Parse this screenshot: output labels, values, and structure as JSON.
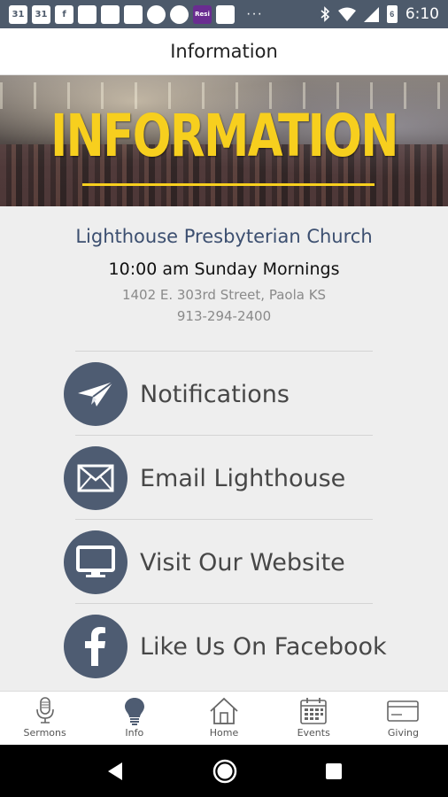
{
  "status_bar": {
    "app_icons": [
      "31",
      "31",
      "f",
      "",
      "",
      "",
      "",
      "",
      "Resi",
      ""
    ],
    "overflow": "···",
    "battery_level": "6",
    "time": "6:10"
  },
  "header": {
    "title": "Information"
  },
  "banner": {
    "text": "INFORMATION"
  },
  "church": {
    "name": "Lighthouse Presbyterian Church",
    "service_time": "10:00 am Sunday Mornings",
    "address": "1402 E. 303rd Street, Paola KS",
    "phone": "913-294-2400"
  },
  "menu": {
    "items": [
      {
        "label": "Notifications",
        "icon": "paper-plane-icon"
      },
      {
        "label": "Email Lighthouse",
        "icon": "envelope-icon"
      },
      {
        "label": "Visit Our Website",
        "icon": "monitor-icon"
      },
      {
        "label": "Like Us On Facebook",
        "icon": "facebook-icon"
      }
    ]
  },
  "bottom_nav": {
    "items": [
      {
        "label": "Sermons",
        "icon": "microphone-icon"
      },
      {
        "label": "Info",
        "icon": "lightbulb-icon"
      },
      {
        "label": "Home",
        "icon": "house-icon"
      },
      {
        "label": "Events",
        "icon": "calendar-icon"
      },
      {
        "label": "Giving",
        "icon": "credit-card-icon"
      }
    ]
  },
  "colors": {
    "status_bar": "#4d5a6b",
    "accent_yellow": "#f7cf1e",
    "menu_circle": "#4e5c72",
    "church_name": "#3c4f70"
  }
}
